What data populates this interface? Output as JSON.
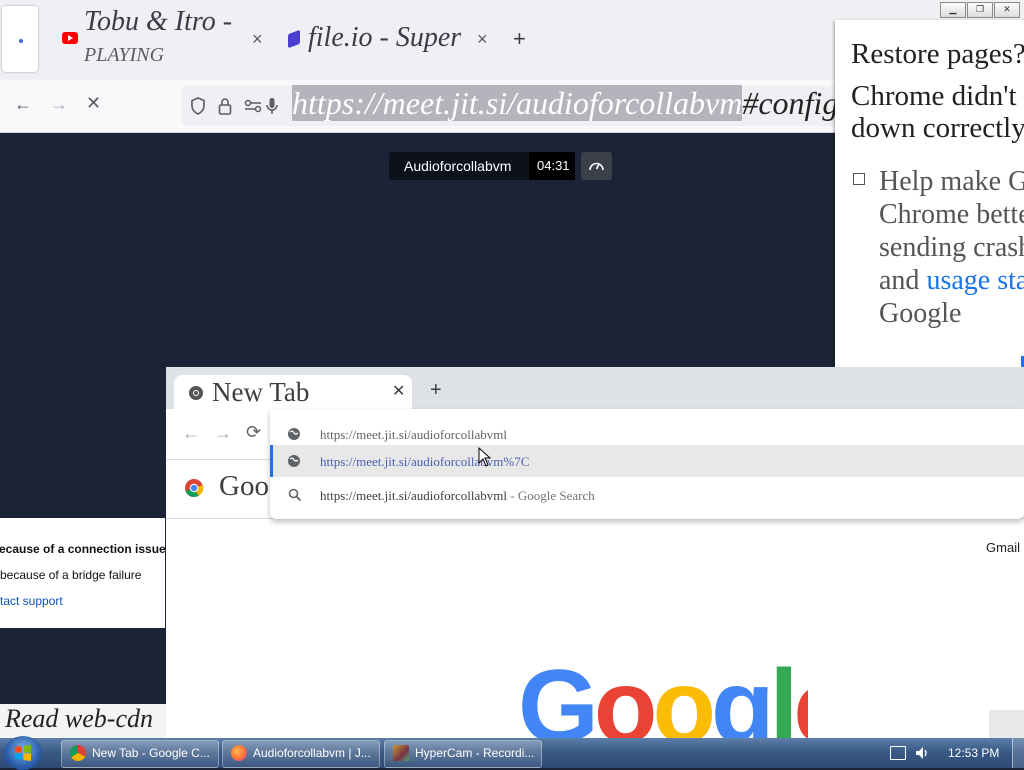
{
  "firefox": {
    "tab1_title": "Tobu & Itro - ",
    "tab1_sub": "PLAYING",
    "tab2_title": "file.io - Super ",
    "close_glyph": "×",
    "newtab_glyph": "+",
    "url_highlighted": "https://meet.jit.si/audioforcollabvm",
    "url_rest": "#config."
  },
  "jitsi": {
    "room_name": "Audioforcollabvm",
    "timer": "04:31",
    "error_line1": "ecause of a connection issue",
    "error_line2": "because of a bridge failure",
    "error_link": "tact support",
    "status_text": "Read web-cdn"
  },
  "restore_dialog": {
    "title": "Restore pages?",
    "message": "Chrome didn't s down correctly.",
    "message_l1": "Chrome didn't s",
    "message_l2": "down correctly.",
    "checkbox_l1": "Help make G",
    "checkbox_l2": "Chrome bette",
    "checkbox_l3": "sending crash",
    "checkbox_l4a": "and ",
    "checkbox_link": "usage sta",
    "checkbox_l5": "Google"
  },
  "chrome": {
    "tab_title": "New Tab",
    "google_partial": "Goog",
    "gmail_link": "Gmail",
    "logo_text": "Google",
    "omnibox": [
      {
        "text": "https://meet.jit.si/audioforcollabvml",
        "suffix": "",
        "icon": "globe-icon"
      },
      {
        "text": "https://meet.jit.si/audioforcollabvm%7C",
        "suffix": "",
        "icon": "globe-icon"
      },
      {
        "text": "https://meet.jit.si/audioforcollabvml",
        "suffix": " - Google Search",
        "icon": "search-icon"
      }
    ]
  },
  "taskbar": {
    "items": [
      {
        "label": "New Tab - Google C...",
        "icon": "chrome-icon"
      },
      {
        "label": "Audioforcollabvm | J...",
        "icon": "firefox-icon"
      },
      {
        "label": "HyperCam - Recordi...",
        "icon": "hypercam-icon"
      }
    ],
    "clock": "12:53 PM"
  },
  "colors": {
    "jitsi_bg": "#1b2436",
    "taskbar": "#3a5a86",
    "google_blue": "#4285f4",
    "google_red": "#ea4335",
    "google_yellow": "#fbbc05",
    "google_green": "#34a853",
    "link_blue": "#1a73e8"
  }
}
